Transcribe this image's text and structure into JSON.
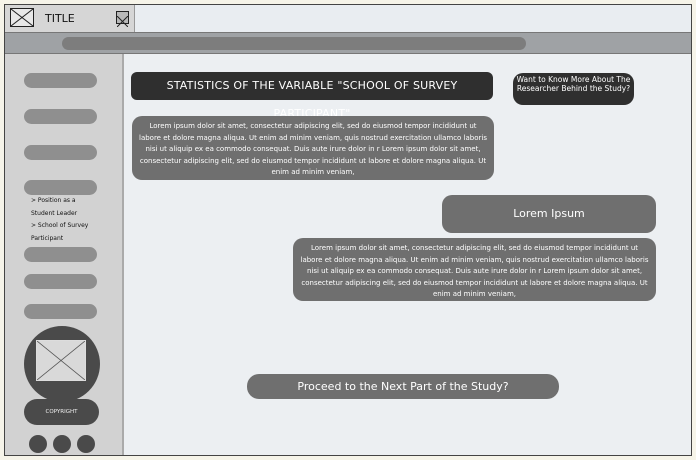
{
  "window": {
    "title": "TITLE"
  },
  "sidebar": {
    "submenu": {
      "position_label": "> Position as a Student Leader",
      "school_label": "> School of Survey Participant"
    },
    "copyright": "COPYRIGHT"
  },
  "main": {
    "heading": "STATISTICS OF THE VARIABLE  \"SCHOOL OF SURVEY PARTICIPANT\"",
    "researcher_button": "Want to Know More About The Researcher Behind the Study?",
    "paragraph1": "Lorem ipsum dolor sit amet, consectetur adipiscing elit, sed do eiusmod tempor incididunt ut labore et dolore magna aliqua. Ut enim ad minim veniam, quis nostrud exercitation ullamco laboris nisi ut aliquip ex ea commodo consequat. Duis aute irure dolor in r Lorem ipsum dolor sit amet, consectetur adipiscing elit, sed do eiusmod tempor incididunt ut labore et dolore magna aliqua. Ut enim ad minim veniam,",
    "subheading": "Lorem Ipsum",
    "paragraph2": "Lorem ipsum dolor sit amet, consectetur adipiscing elit, sed do eiusmod tempor incididunt ut labore et dolore magna aliqua. Ut enim ad minim veniam, quis nostrud exercitation ullamco laboris nisi ut aliquip ex ea commodo consequat. Duis aute irure dolor in r Lorem ipsum dolor sit amet, consectetur adipiscing elit, sed do eiusmod tempor incididunt ut labore et dolore magna aliqua. Ut enim ad minim veniam,",
    "proceed_button": "Proceed to the Next Part of the Study?"
  },
  "icons": {
    "app": "image-placeholder-icon",
    "close": "close-icon",
    "avatar": "image-placeholder-icon"
  },
  "colors": {
    "dark_block": "#2f2f2f",
    "mid_block": "#6f6f6f",
    "sidebar": "#d2d2d2",
    "content_bg": "#eceff2"
  }
}
